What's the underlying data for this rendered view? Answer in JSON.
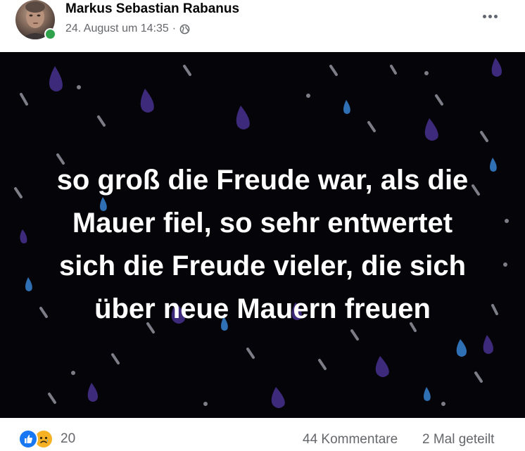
{
  "post": {
    "author": "Markus Sebastian Rabanus",
    "timestamp": "24. August um 14:35",
    "separator": "·",
    "privacy_icon": "globe-icon",
    "more_icon": "more-options-icon"
  },
  "image": {
    "quote_lines": [
      "so groß die Freude war, als die",
      "Mauer fiel, so sehr entwertet",
      "sich die Freude vieler, die sich",
      "über neue Mauern freuen"
    ],
    "background_color": "#050408",
    "drop_colors": [
      "#3d2a7a",
      "#2f6fb3",
      "#7d7d87"
    ]
  },
  "footer": {
    "reaction_icons": [
      "like-icon",
      "sad-icon"
    ],
    "reaction_count": "20",
    "comments": "44 Kommentare",
    "shares": "2 Mal geteilt"
  },
  "colors": {
    "online": "#31a24c",
    "like": "#1877f2",
    "sad": "#f7b125",
    "secondary_text": "#65676b"
  }
}
